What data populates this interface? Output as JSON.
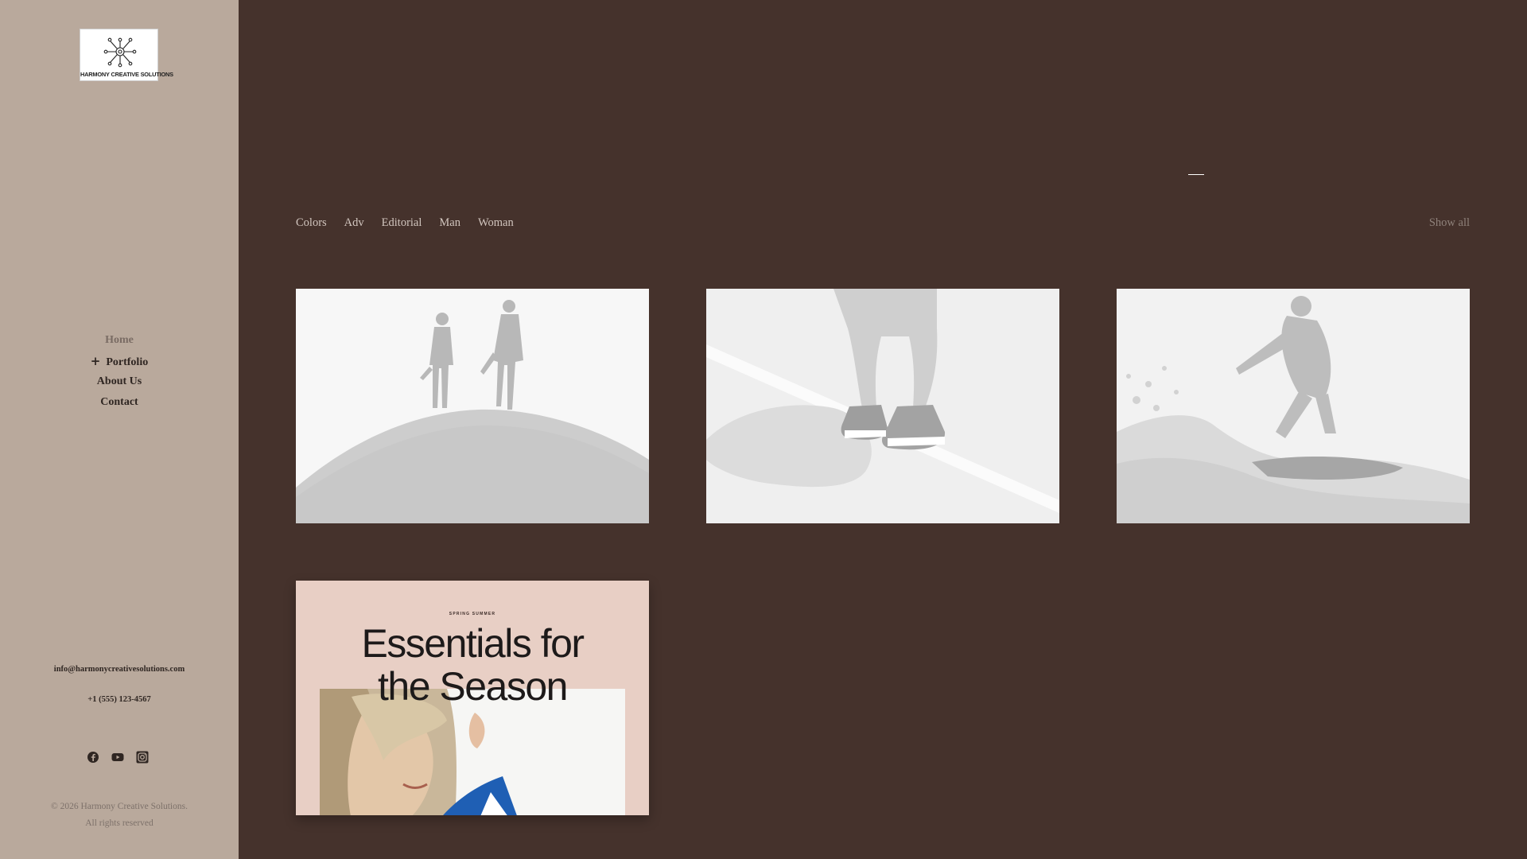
{
  "brand": {
    "logo_text": "HARMONY CREATIVE SOLUTIONS"
  },
  "nav": {
    "items": [
      {
        "label": "Home",
        "active": true
      },
      {
        "label": "Portfolio",
        "expandable_icon": "plus-icon"
      },
      {
        "label": "About Us"
      },
      {
        "label": "Contact"
      }
    ]
  },
  "contact": {
    "email": "info@harmonycreativesolutions.com",
    "phone": "+1 (555) 123-4567"
  },
  "social": [
    "facebook-icon",
    "youtube-icon",
    "instagram-icon"
  ],
  "footer": {
    "copyright": "© 2026 Harmony Creative Solutions.",
    "rights": "All rights reserved"
  },
  "filters": {
    "items": [
      "Colors",
      "Adv",
      "Editorial",
      "Man",
      "Woman"
    ],
    "show_all": "Show all"
  },
  "gallery": {
    "tiles": [
      {
        "subject": "two people walking on sand dune",
        "style": "washed-out greyscale"
      },
      {
        "subject": "legs in jeans and sneakers on road line",
        "style": "washed-out greyscale"
      },
      {
        "subject": "surfer riding a wave",
        "style": "washed-out greyscale"
      },
      {
        "subject": "poster",
        "poster_kicker": "SPRING SUMMER",
        "poster_title_line1": "Essentials for",
        "poster_title_line2": "the Season"
      }
    ]
  },
  "colors": {
    "sidebar_bg": "#b9a99c",
    "main_bg": "#45322c",
    "poster_bg": "#e8cfc5"
  }
}
